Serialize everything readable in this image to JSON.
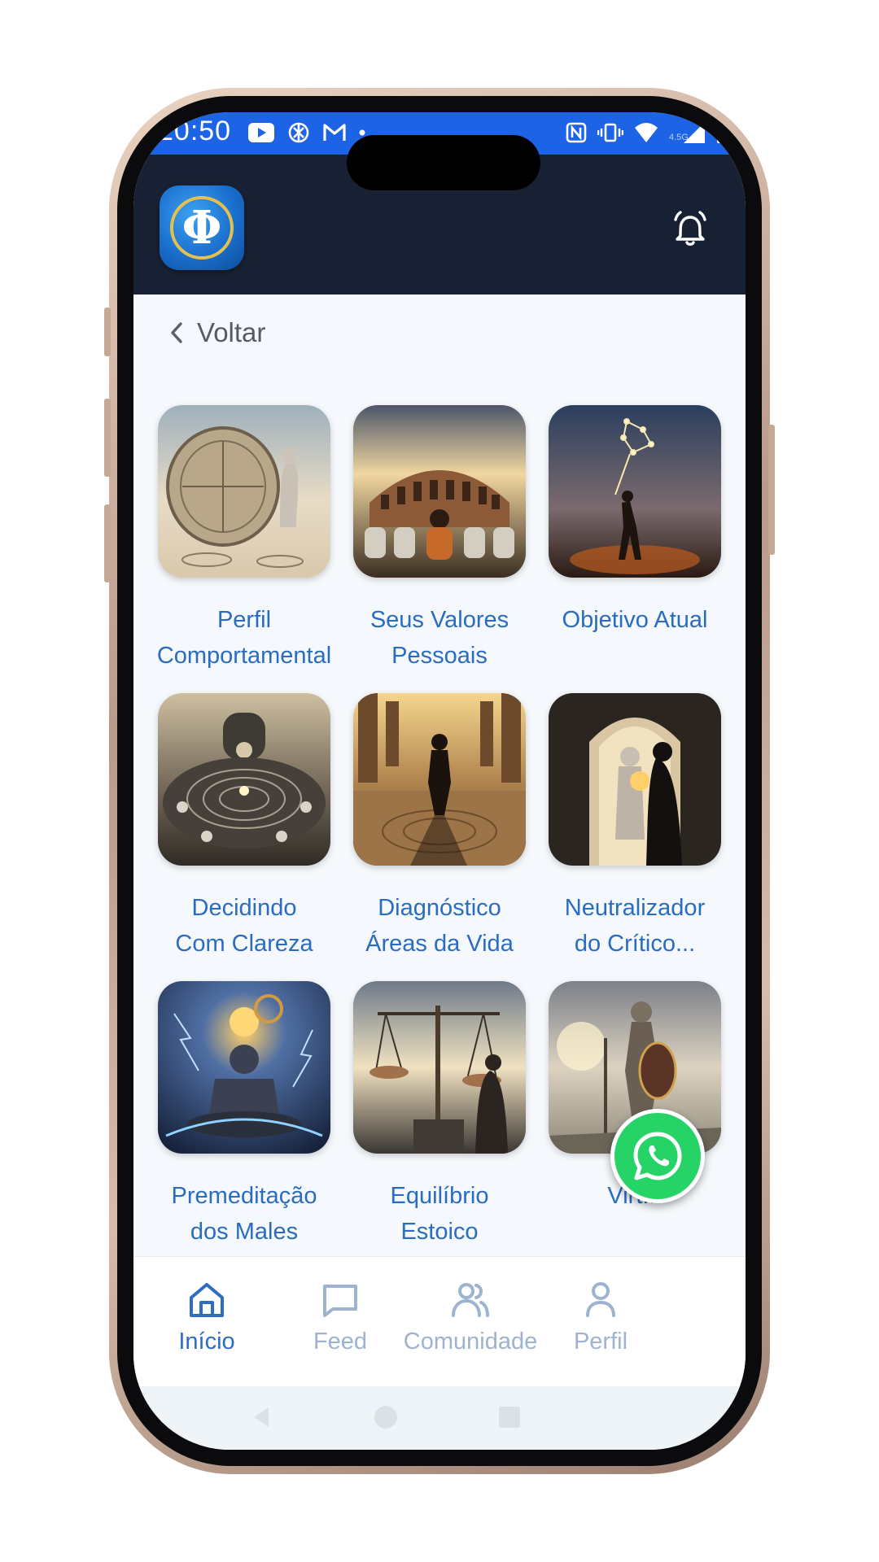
{
  "status_bar": {
    "time": "20:50",
    "network_label": "4.5G",
    "color": "#1c63e6"
  },
  "header": {
    "logo_letter": "Φ",
    "bell_icon": "bell-icon",
    "background": "#182133"
  },
  "back": {
    "label": "Voltar"
  },
  "cards": [
    {
      "label": "Perfil\nComportamental",
      "icon": "stoic-compass-image"
    },
    {
      "label": "Seus Valores\nPessoais",
      "icon": "colosseum-image"
    },
    {
      "label": "Objetivo Atual",
      "icon": "archer-constellation-image"
    },
    {
      "label": "Decidindo\nCom Clareza",
      "icon": "labyrinth-table-image"
    },
    {
      "label": "Diagnóstico\nÁreas da Vida",
      "icon": "temple-path-image"
    },
    {
      "label": "Neutralizador\ndo Crítico...",
      "icon": "statue-arch-image"
    },
    {
      "label": "Premeditação\ndos Males",
      "icon": "meditating-sage-image"
    },
    {
      "label": "Equilíbrio\nEstoico",
      "icon": "scales-image"
    },
    {
      "label": "Virt...",
      "icon": "armored-statue-image"
    }
  ],
  "fab": {
    "icon": "whatsapp-icon",
    "color": "#25d366"
  },
  "bottom_nav": {
    "items": [
      {
        "label": "Início",
        "icon": "home-icon",
        "active": true
      },
      {
        "label": "Feed",
        "icon": "chat-bubble-icon",
        "active": false
      },
      {
        "label": "Comunidade",
        "icon": "users-icon",
        "active": false
      },
      {
        "label": "Perfil",
        "icon": "user-icon",
        "active": false
      }
    ],
    "active_color": "#2e6dbf",
    "inactive_color": "#9db3cf"
  }
}
